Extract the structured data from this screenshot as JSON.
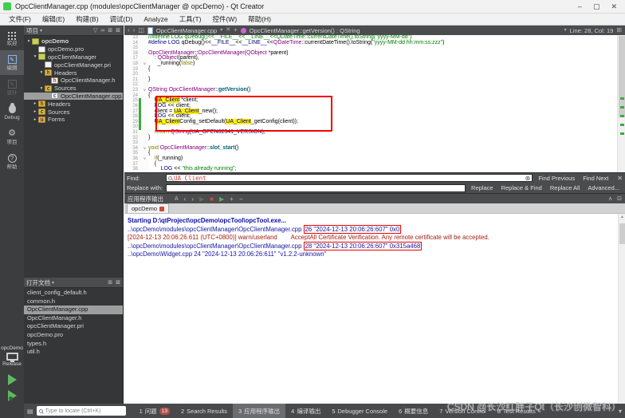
{
  "icons": {
    "minimize": "–",
    "maximize": "▢",
    "close": "✕",
    "dropdown": "▾",
    "filter": "▽",
    "link": "∞",
    "split": "⊞",
    "panel_close": "⊠",
    "back": "‹",
    "forward": "›",
    "split_editor": "◫",
    "tab_close": "✕",
    "pin": "+",
    "collapse": "∧",
    "popout": "⊡",
    "clear": "⊗",
    "wrap": "A",
    "nav_prev": "‹",
    "nav_next": "›",
    "run_small": "▶",
    "stop_small": "■",
    "add": "+",
    "remove": "−",
    "gear": "⚙",
    "hammer": "⚒",
    "panes_menu": "▾",
    "output_panes": "▤",
    "scroll_up": "▲"
  },
  "window": {
    "title": "OpcClientManager.cpp (modules\\opcClientManager @ opcDemo) - Qt Creator"
  },
  "menu": {
    "items": [
      "文件(F)",
      "编辑(E)",
      "构建(B)",
      "调试(D)",
      "Analyze",
      "工具(T)",
      "控件(W)",
      "帮助(H)"
    ]
  },
  "mode_bar": {
    "modes": [
      {
        "label": "欢迎",
        "icon": "welcome"
      },
      {
        "label": "编辑",
        "icon": "edit",
        "active": true
      },
      {
        "label": "设计",
        "icon": "design",
        "disabled": true
      },
      {
        "label": "Debug",
        "icon": "debug"
      },
      {
        "label": "项目",
        "icon": "projects"
      },
      {
        "label": "帮助",
        "icon": "help"
      }
    ],
    "kit": {
      "project": "opcDemo",
      "config": "Release"
    }
  },
  "project_panel": {
    "title": "项目",
    "tree": [
      {
        "label": "opcDemo",
        "depth": 0,
        "icon": "project",
        "arrow": "expanded",
        "bold": true
      },
      {
        "label": "opcDemo.pro",
        "depth": 1,
        "icon": "file-pro"
      },
      {
        "label": "opcClientManager",
        "depth": 1,
        "icon": "project-sub",
        "arrow": "expanded"
      },
      {
        "label": "opcClientManager.pri",
        "depth": 2,
        "icon": "file-pri"
      },
      {
        "label": "Headers",
        "depth": 2,
        "icon": "folder-h",
        "arrow": "expanded"
      },
      {
        "label": "OpcClientManager.h",
        "depth": 3,
        "icon": "file-h"
      },
      {
        "label": "Sources",
        "depth": 2,
        "icon": "folder-c",
        "arrow": "expanded"
      },
      {
        "label": "OpcClientManager.cpp",
        "depth": 3,
        "icon": "file-cpp",
        "selected": true
      },
      {
        "label": "Headers",
        "depth": 1,
        "icon": "folder-h",
        "arrow": "collapsed"
      },
      {
        "label": "Sources",
        "depth": 1,
        "icon": "folder-c",
        "arrow": "collapsed"
      },
      {
        "label": "Forms",
        "depth": 1,
        "icon": "folder-ui",
        "arrow": "collapsed"
      }
    ]
  },
  "open_documents": {
    "title": "打开文档",
    "files": [
      {
        "label": "client_config_default.h"
      },
      {
        "label": "common.h"
      },
      {
        "label": "OpcClientManager.cpp",
        "selected": true
      },
      {
        "label": "OpcClientManager.h"
      },
      {
        "label": "opcClientManager.pri"
      },
      {
        "label": "opcDemo.pro"
      },
      {
        "label": "types.h"
      },
      {
        "label": "util.h"
      }
    ]
  },
  "editor": {
    "toolbar": {
      "file": "OpcClientManager.cpp",
      "symbol": "OpcClientManager::getVersion() : QString",
      "line_col": "Line: 28, Col: 19"
    },
    "lines": [
      {
        "n": 13,
        "toks": [
          [
            "//#define LOG qDebug()<<__FILE__<<__LINE__<<QDateTime::currentDateTime().toString(\"yyyy-MM-dd\")",
            "comment"
          ]
        ]
      },
      {
        "n": 14,
        "toks": [
          [
            "#define ",
            "pp"
          ],
          [
            "LOG",
            "macro"
          ],
          [
            " qDebug()<<",
            "plain"
          ],
          [
            "__FILE__",
            "pp"
          ],
          [
            "<<",
            "plain"
          ],
          [
            "__LINE__",
            "pp"
          ],
          [
            "<<",
            "plain"
          ],
          [
            "QDateTime",
            "type"
          ],
          [
            "::currentDateTime().toString(",
            "plain"
          ],
          [
            "\"yyyy-MM-dd hh:mm:ss:zzz\"",
            "str"
          ],
          [
            ")",
            "plain"
          ]
        ]
      },
      {
        "n": 15,
        "toks": []
      },
      {
        "n": 16,
        "toks": [
          [
            "OpcClientManager",
            "type"
          ],
          [
            "::",
            "plain"
          ],
          [
            "OpcClientManager",
            "type"
          ],
          [
            "(",
            "plain"
          ],
          [
            "QObject",
            "type"
          ],
          [
            " *parent)",
            "plain"
          ]
        ]
      },
      {
        "n": 17,
        "toks": [
          [
            "    : ",
            "plain"
          ],
          [
            "QObject",
            "type"
          ],
          [
            "(parent),",
            "plain"
          ]
        ]
      },
      {
        "n": 18,
        "fold": true,
        "toks": [
          [
            "      _running(",
            "plain"
          ],
          [
            "false",
            "kw"
          ],
          [
            ")",
            "plain"
          ]
        ]
      },
      {
        "n": 19,
        "toks": [
          [
            "{",
            "plain"
          ]
        ]
      },
      {
        "n": 20,
        "toks": []
      },
      {
        "n": 21,
        "toks": [
          [
            "}",
            "plain"
          ]
        ]
      },
      {
        "n": 22,
        "toks": []
      },
      {
        "n": 23,
        "fold": true,
        "toks": [
          [
            "QString",
            "type"
          ],
          [
            " ",
            "plain"
          ],
          [
            "OpcClientManager",
            "type"
          ],
          [
            "::",
            "plain"
          ],
          [
            "getVersion",
            "func"
          ],
          [
            "()",
            "plain"
          ]
        ]
      },
      {
        "n": 24,
        "toks": [
          [
            "{",
            "plain"
          ]
        ]
      },
      {
        "n": 25,
        "chg": true,
        "toks": [
          [
            "    ",
            "plain"
          ],
          [
            "UA_Client",
            "hl"
          ],
          [
            " *client;",
            "plain"
          ]
        ]
      },
      {
        "n": 26,
        "chg": true,
        "toks": [
          [
            "    ",
            "plain"
          ],
          [
            "LOG",
            "macro"
          ],
          [
            " << client;",
            "plain"
          ]
        ]
      },
      {
        "n": 27,
        "chg": true,
        "toks": [
          [
            "    client = ",
            "plain"
          ],
          [
            "UA_Client",
            "hl"
          ],
          [
            "_new();",
            "plain"
          ]
        ]
      },
      {
        "n": 28,
        "chg": true,
        "toks": [
          [
            "    ",
            "plain"
          ],
          [
            "LOG",
            "macro"
          ],
          [
            " << client;",
            "plain"
          ]
        ]
      },
      {
        "n": 29,
        "chg": true,
        "toks": [
          [
            "    ",
            "plain"
          ],
          [
            "UA_Client",
            "hl"
          ],
          [
            "Config_setDefault(",
            "plain"
          ],
          [
            "UA_Client",
            "hl"
          ],
          [
            "_getConfig(client));",
            "plain"
          ]
        ]
      },
      {
        "n": 30,
        "chg": true,
        "toks": []
      },
      {
        "n": 31,
        "toks": [
          [
            "    ",
            "plain"
          ],
          [
            "return",
            "kw"
          ],
          [
            " ",
            "plain"
          ],
          [
            "QString",
            "type"
          ],
          [
            "(",
            "plain"
          ],
          [
            "UA_OPEN62541_VERSION",
            "pp"
          ],
          [
            ");",
            "plain"
          ]
        ]
      },
      {
        "n": 32,
        "toks": [
          [
            "}",
            "plain"
          ]
        ]
      },
      {
        "n": 33,
        "toks": []
      },
      {
        "n": 34,
        "fold": true,
        "toks": [
          [
            "void",
            "kw"
          ],
          [
            " ",
            "plain"
          ],
          [
            "OpcClientManager",
            "type"
          ],
          [
            "::",
            "plain"
          ],
          [
            "slot_start",
            "func"
          ],
          [
            "()",
            "plain"
          ]
        ]
      },
      {
        "n": 35,
        "toks": [
          [
            "{",
            "plain"
          ]
        ]
      },
      {
        "n": 36,
        "fold": true,
        "toks": [
          [
            "    ",
            "plain"
          ],
          [
            "if",
            "kw"
          ],
          [
            "(_running)",
            "plain"
          ]
        ]
      },
      {
        "n": 37,
        "toks": [
          [
            "    {",
            "plain"
          ]
        ]
      },
      {
        "n": 38,
        "toks": [
          [
            "        ",
            "plain"
          ],
          [
            "LOG",
            "macro"
          ],
          [
            " << ",
            "plain"
          ],
          [
            "\"this already running\";",
            "str"
          ]
        ]
      }
    ]
  },
  "find_bar": {
    "find_label": "Find:",
    "find_value": "UA_Client",
    "replace_label": "Replace with:",
    "replace_value": "",
    "row1_buttons": [
      "Find Previous",
      "Find Next"
    ],
    "row2_buttons": [
      "Replace",
      "Replace & Find",
      "Replace All",
      "Advanced..."
    ]
  },
  "output_pane": {
    "title": "应用程序输出",
    "tab": "opcDemo",
    "console": [
      {
        "style": "start",
        "segs": [
          {
            "t": "Starting D:\\qtProject\\opcDemo\\opcTool\\opcTool.exe..."
          }
        ]
      },
      {
        "style": "debug",
        "segs": [
          {
            "t": "..\\opcDemo\\modules\\opcClientManager\\OpcClientManager.cpp "
          },
          {
            "t": "26 \"2024-12-13 20:06:26:607\" 0x0",
            "box": true
          }
        ]
      },
      {
        "style": "warn",
        "segs": [
          {
            "t": "[2024-12-13 20:06:26.611 (UTC+0800)] warn/userland        AcceptAll Certificate Verification. Any remote certificate will be accepted."
          }
        ]
      },
      {
        "style": "debug",
        "segs": [
          {
            "t": "..\\opcDemo\\modules\\opcClientManager\\OpcClientManager.cpp "
          },
          {
            "t": "28 \"2024-12-13 20:06:26:607\" 0x315a468",
            "box": true
          }
        ]
      },
      {
        "style": "debug",
        "segs": [
          {
            "t": "..\\opcDemo\\Widget.cpp 24 \"2024-12-13 20:06:26:611\" \"v1.2.2-unknown\""
          }
        ]
      }
    ]
  },
  "status_bar": {
    "locator_placeholder": "Type to locate (Ctrl+K)",
    "buttons": [
      {
        "key": "1",
        "label": "问题",
        "badge": "13"
      },
      {
        "key": "2",
        "label": "Search Results"
      },
      {
        "key": "3",
        "label": "应用程序输出",
        "active": true
      },
      {
        "key": "4",
        "label": "编译输出"
      },
      {
        "key": "5",
        "label": "Debugger Console"
      },
      {
        "key": "6",
        "label": "概要信息"
      },
      {
        "key": "7",
        "label": "Version Control"
      },
      {
        "key": "8",
        "label": "Test Results"
      }
    ]
  },
  "watermark": "CSDN @长沙红胖子Qt（长沙创微智科）"
}
